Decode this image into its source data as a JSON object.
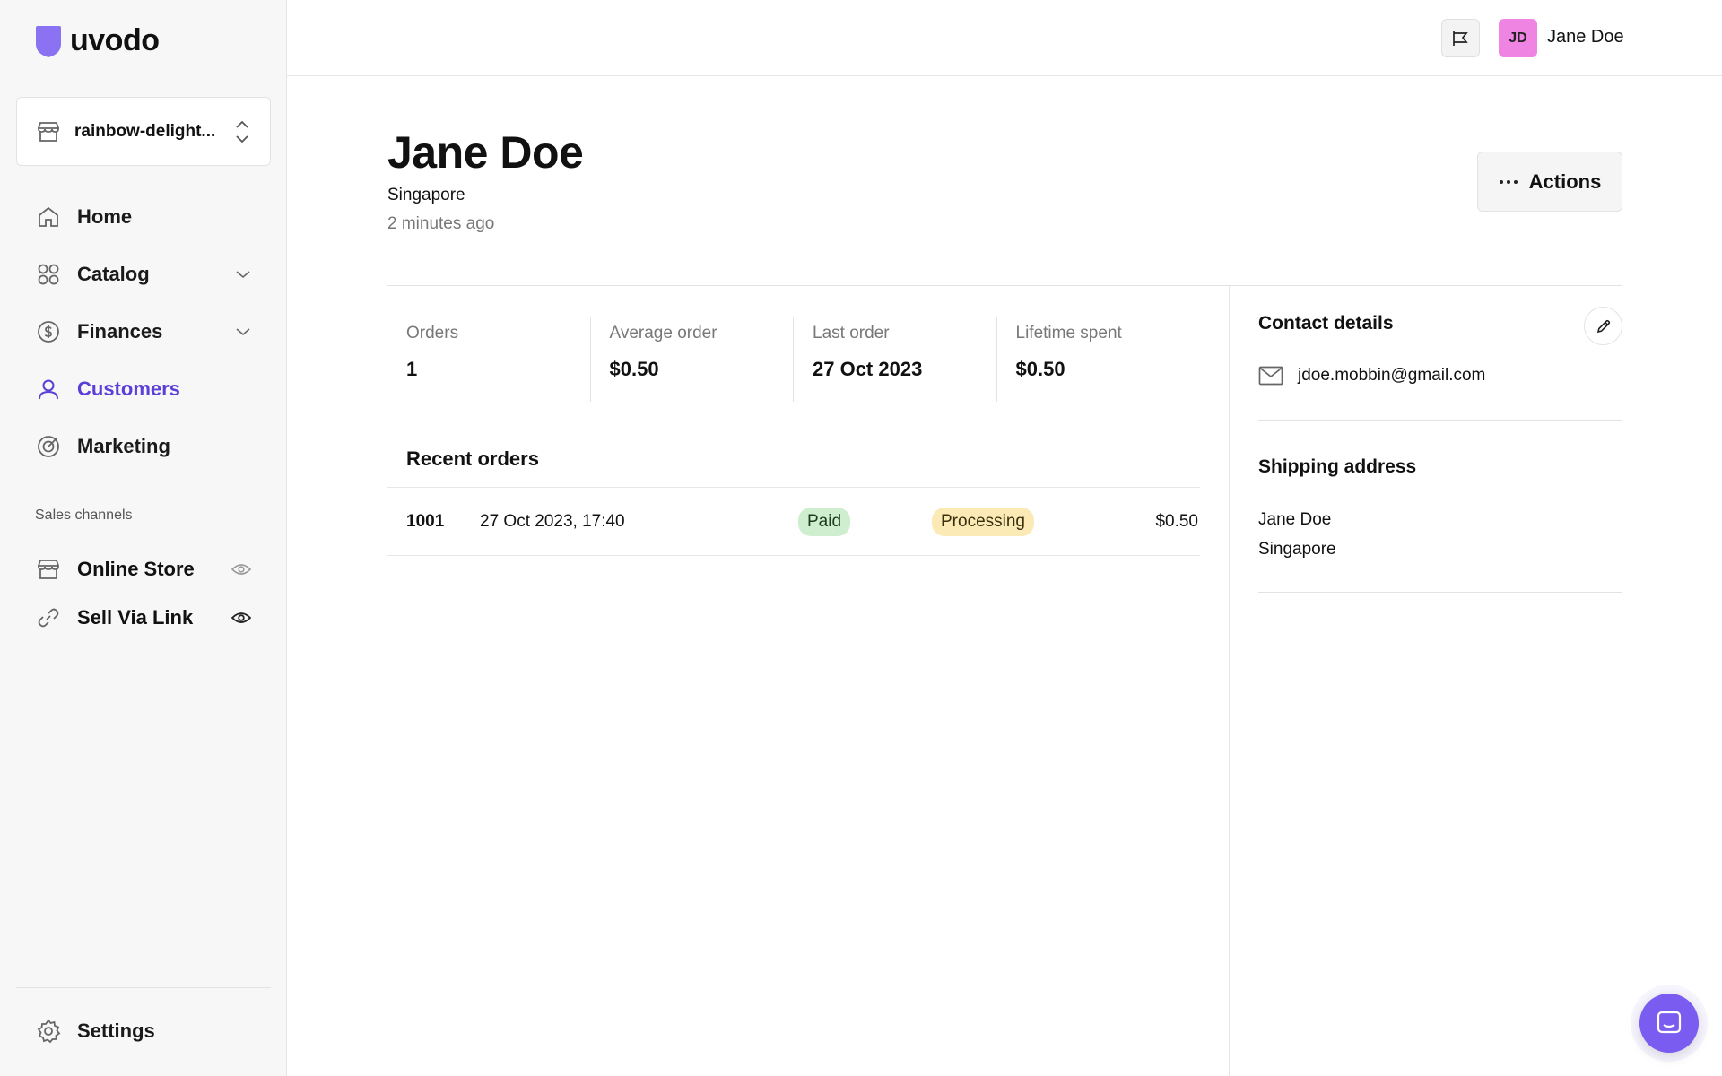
{
  "brand": {
    "name": "uvodo",
    "accent": "#5b3fd6",
    "logo_color": "#8a72f2"
  },
  "store_switcher": {
    "name": "rainbow-delight..."
  },
  "nav": [
    {
      "label": "Home",
      "icon": "home-icon",
      "expandable": false,
      "active": false
    },
    {
      "label": "Catalog",
      "icon": "grid-icon",
      "expandable": true,
      "active": false
    },
    {
      "label": "Finances",
      "icon": "dollar-icon",
      "expandable": true,
      "active": false
    },
    {
      "label": "Customers",
      "icon": "user-icon",
      "expandable": false,
      "active": true
    },
    {
      "label": "Marketing",
      "icon": "target-icon",
      "expandable": false,
      "active": false
    }
  ],
  "sales_channels": {
    "label": "Sales channels",
    "items": [
      {
        "label": "Online Store",
        "icon": "store-icon",
        "visibility": "eye-icon"
      },
      {
        "label": "Sell Via Link",
        "icon": "link-icon",
        "visibility": "eye-icon"
      }
    ]
  },
  "settings": {
    "label": "Settings",
    "icon": "gear-icon"
  },
  "topbar": {
    "user": {
      "initials": "JD",
      "name": "Jane Doe",
      "avatar_color": "#ef84e2"
    }
  },
  "customer": {
    "name": "Jane Doe",
    "location": "Singapore",
    "last_active": "2 minutes ago",
    "actions_label": "Actions"
  },
  "stats": [
    {
      "label": "Orders",
      "value": "1"
    },
    {
      "label": "Average order",
      "value": "$0.50"
    },
    {
      "label": "Last order",
      "value": "27 Oct 2023"
    },
    {
      "label": "Lifetime spent",
      "value": "$0.50"
    }
  ],
  "recent_orders": {
    "title": "Recent orders",
    "rows": [
      {
        "number": "1001",
        "date": "27 Oct 2023, 17:40",
        "payment_status": "Paid",
        "fulfillment_status": "Processing",
        "total": "$0.50"
      }
    ]
  },
  "contact": {
    "title": "Contact details",
    "email": "jdoe.mobbin@gmail.com"
  },
  "shipping": {
    "title": "Shipping address",
    "name": "Jane Doe",
    "country": "Singapore"
  }
}
